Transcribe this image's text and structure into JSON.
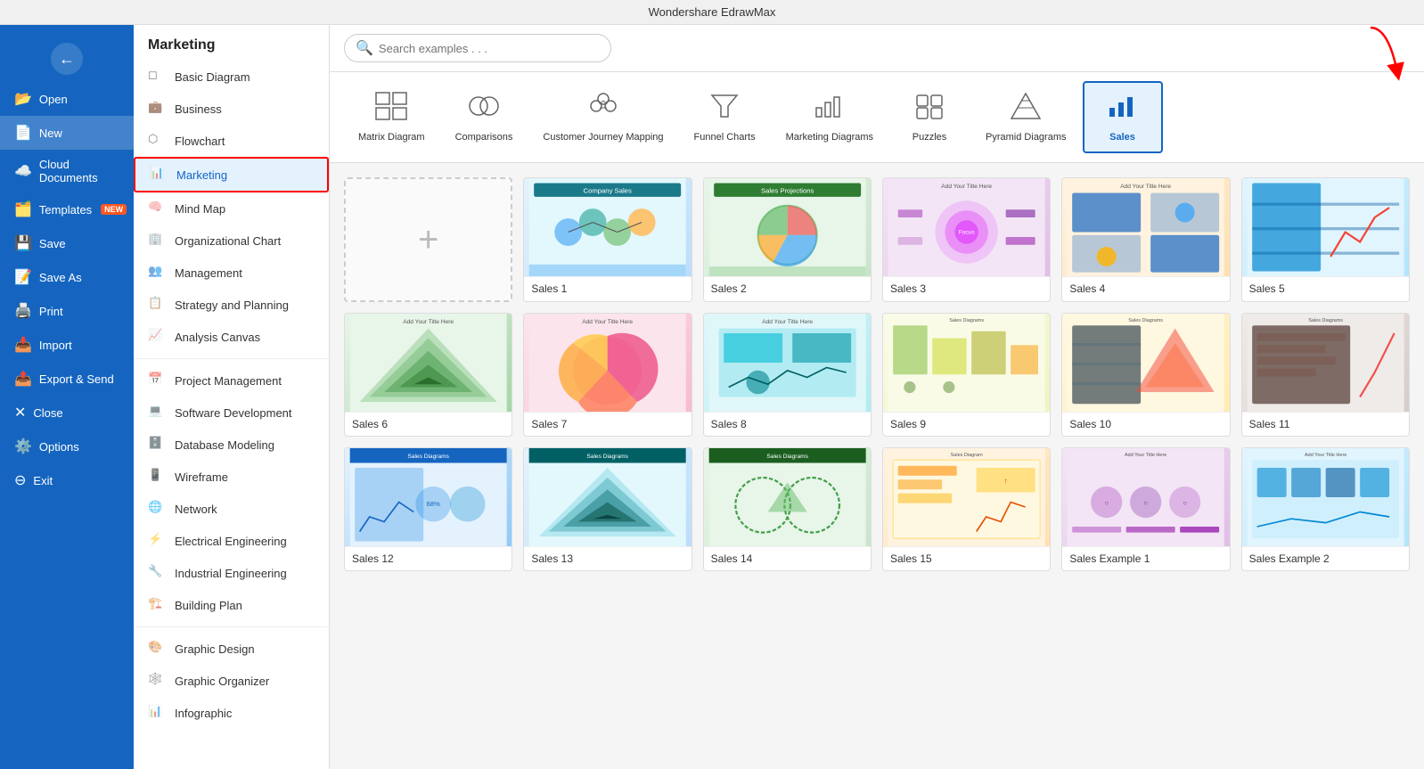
{
  "titleBar": {
    "label": "Wondershare EdrawMax"
  },
  "sidebar": {
    "backButton": "←",
    "items": [
      {
        "id": "open",
        "label": "Open",
        "icon": "📂"
      },
      {
        "id": "new",
        "label": "New",
        "icon": "📄",
        "active": true
      },
      {
        "id": "cloud",
        "label": "Cloud Documents",
        "icon": "☁️"
      },
      {
        "id": "templates",
        "label": "Templates",
        "icon": "🗂️",
        "badge": "NEW"
      },
      {
        "id": "save",
        "label": "Save",
        "icon": "💾"
      },
      {
        "id": "saveas",
        "label": "Save As",
        "icon": "📝"
      },
      {
        "id": "print",
        "label": "Print",
        "icon": "🖨️"
      },
      {
        "id": "import",
        "label": "Import",
        "icon": "📥"
      },
      {
        "id": "export",
        "label": "Export & Send",
        "icon": "📤"
      },
      {
        "id": "close",
        "label": "Close",
        "icon": "✕"
      },
      {
        "id": "options",
        "label": "Options",
        "icon": "⚙️"
      },
      {
        "id": "exit",
        "label": "Exit",
        "icon": "⊖"
      }
    ]
  },
  "categoryPanel": {
    "header": "Marketing",
    "categories": [
      {
        "id": "basic",
        "label": "Basic Diagram",
        "icon": "◻"
      },
      {
        "id": "business",
        "label": "Business",
        "icon": "💼"
      },
      {
        "id": "flowchart",
        "label": "Flowchart",
        "icon": "⬡"
      },
      {
        "id": "marketing",
        "label": "Marketing",
        "icon": "📊",
        "active": true,
        "highlighted": true
      },
      {
        "id": "mindmap",
        "label": "Mind Map",
        "icon": "🧠"
      },
      {
        "id": "orgchart",
        "label": "Organizational Chart",
        "icon": "🏢"
      },
      {
        "id": "management",
        "label": "Management",
        "icon": "👥"
      },
      {
        "id": "strategy",
        "label": "Strategy and Planning",
        "icon": "📋"
      },
      {
        "id": "analysis",
        "label": "Analysis Canvas",
        "icon": "📈"
      },
      {
        "divider": true
      },
      {
        "id": "project",
        "label": "Project Management",
        "icon": "📅"
      },
      {
        "id": "software",
        "label": "Software Development",
        "icon": "💻"
      },
      {
        "id": "database",
        "label": "Database Modeling",
        "icon": "🗄️"
      },
      {
        "id": "wireframe",
        "label": "Wireframe",
        "icon": "📱"
      },
      {
        "id": "network",
        "label": "Network",
        "icon": "🌐"
      },
      {
        "id": "electrical",
        "label": "Electrical Engineering",
        "icon": "⚡"
      },
      {
        "id": "industrial",
        "label": "Industrial Engineering",
        "icon": "🔧"
      },
      {
        "id": "building",
        "label": "Building Plan",
        "icon": "🏗️"
      },
      {
        "divider": true
      },
      {
        "id": "graphic",
        "label": "Graphic Design",
        "icon": "🎨"
      },
      {
        "id": "organizer",
        "label": "Graphic Organizer",
        "icon": "🕸️"
      },
      {
        "id": "infographic",
        "label": "Infographic",
        "icon": "📊"
      }
    ]
  },
  "search": {
    "placeholder": "Search examples . . ."
  },
  "templateStrip": {
    "categories": [
      {
        "id": "matrix",
        "label": "Matrix Diagram",
        "icon": "⊞"
      },
      {
        "id": "comparisons",
        "label": "Comparisons",
        "icon": "⚖"
      },
      {
        "id": "customer",
        "label": "Customer Journey Mapping",
        "icon": "⊙"
      },
      {
        "id": "funnel",
        "label": "Funnel Charts",
        "icon": "▽"
      },
      {
        "id": "marketing",
        "label": "Marketing Diagrams",
        "icon": "▦"
      },
      {
        "id": "puzzles",
        "label": "Puzzles",
        "icon": "⊞"
      },
      {
        "id": "pyramid",
        "label": "Pyramid Diagrams",
        "icon": "△"
      },
      {
        "id": "sales",
        "label": "Sales",
        "icon": "📊",
        "active": true,
        "highlighted": true
      }
    ]
  },
  "templates": {
    "newCard": {
      "icon": "+",
      "label": ""
    },
    "items": [
      {
        "id": "sales1",
        "label": "Sales 1",
        "thumbClass": "thumb-1"
      },
      {
        "id": "sales2",
        "label": "Sales 2",
        "thumbClass": "thumb-2"
      },
      {
        "id": "sales3",
        "label": "Sales 3",
        "thumbClass": "thumb-4"
      },
      {
        "id": "sales4",
        "label": "Sales 4",
        "thumbClass": "thumb-3"
      },
      {
        "id": "sales5",
        "label": "Sales 5",
        "thumbClass": "thumb-5"
      },
      {
        "id": "sales6",
        "label": "Sales 6",
        "thumbClass": "thumb-6"
      },
      {
        "id": "sales7",
        "label": "Sales 7",
        "thumbClass": "thumb-7"
      },
      {
        "id": "sales8",
        "label": "Sales 8",
        "thumbClass": "thumb-8"
      },
      {
        "id": "sales9",
        "label": "Sales 9",
        "thumbClass": "thumb-9"
      },
      {
        "id": "sales10",
        "label": "Sales 10",
        "thumbClass": "thumb-10"
      },
      {
        "id": "sales11",
        "label": "Sales 11",
        "thumbClass": "thumb-11"
      },
      {
        "id": "sales12",
        "label": "Sales 12",
        "thumbClass": "thumb-12"
      },
      {
        "id": "sales13",
        "label": "Sales 13",
        "thumbClass": "thumb-1"
      },
      {
        "id": "sales14",
        "label": "Sales 14",
        "thumbClass": "thumb-2"
      },
      {
        "id": "sales15",
        "label": "Sales 15",
        "thumbClass": "thumb-3"
      },
      {
        "id": "salesex1",
        "label": "Sales Example 1",
        "thumbClass": "thumb-4"
      },
      {
        "id": "salesex2",
        "label": "Sales Example 2",
        "thumbClass": "thumb-5"
      }
    ]
  },
  "redArrows": {
    "categoryArrow": "→",
    "stripArrow": "→"
  }
}
